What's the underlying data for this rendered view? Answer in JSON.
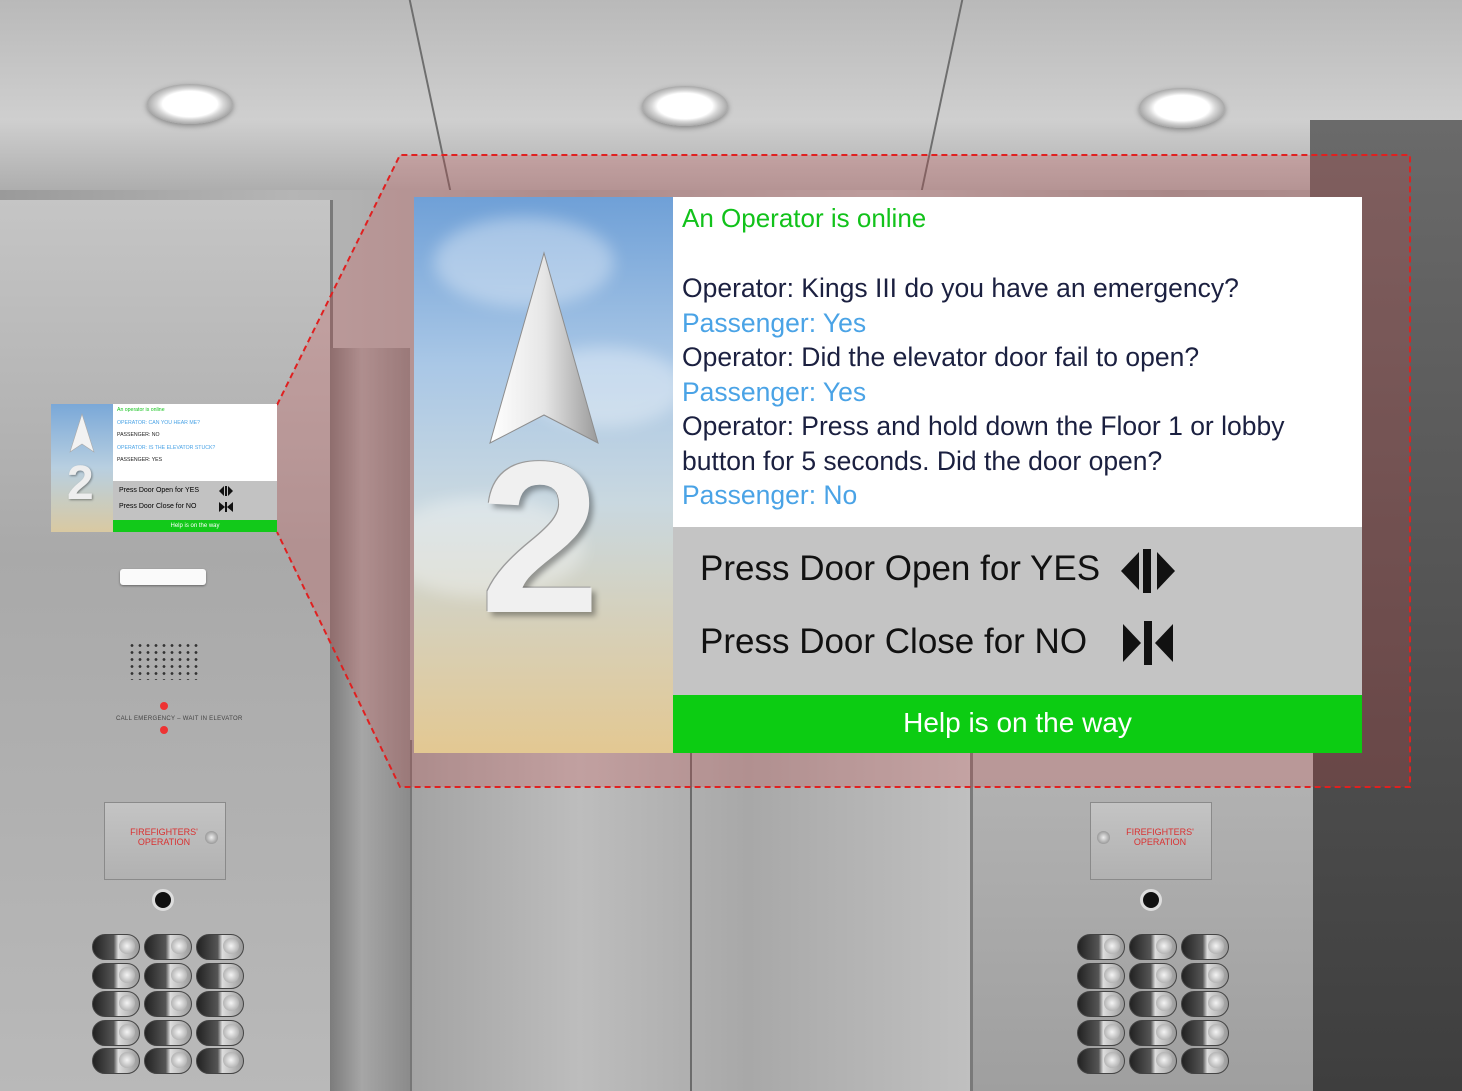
{
  "screen": {
    "floor_number": "2",
    "status": "An Operator is online",
    "conversation": [
      {
        "speaker": "operator",
        "text": "Operator: Kings III do you have an emergency?"
      },
      {
        "speaker": "passenger",
        "text": "Passenger: Yes"
      },
      {
        "speaker": "operator",
        "text": "Operator: Did the elevator door fail to open?"
      },
      {
        "speaker": "passenger",
        "text": "Passenger: Yes"
      },
      {
        "speaker": "operator",
        "text": "Operator: Press and hold down the Floor 1 or lobby button for 5 seconds. Did the door open?"
      },
      {
        "speaker": "passenger",
        "text": "Passenger: No"
      }
    ],
    "prompt_yes": "Press Door Open for YES",
    "prompt_no": "Press Door Close for NO",
    "yes_icon": "door-open-icon",
    "no_icon": "door-close-icon",
    "help_text": "Help is on the way"
  },
  "mini_display": {
    "status": "An operator is online",
    "lines": [
      {
        "speaker": "operator",
        "text": "OPERATOR: CAN YOU HEAR ME?"
      },
      {
        "speaker": "passenger",
        "text": "PASSENGER: NO"
      },
      {
        "speaker": "operator",
        "text": "OPERATOR: IS THE ELEVATOR STUCK?"
      },
      {
        "speaker": "passenger",
        "text": "PASSENGER: YES"
      }
    ],
    "prompt_yes": "Press Door Open for YES",
    "prompt_no": "Press Door Close for NO",
    "help_text": "Help is on the way",
    "floor_number": "2"
  },
  "panel": {
    "call_label": "CALL EMERGENCY – WAIT IN ELEVATOR",
    "firefighters_left": "FIREFIGHTERS' OPERATION",
    "firefighters_right": "FIREFIGHTERS' OPERATION"
  },
  "colors": {
    "status_green": "#12c21b",
    "operator_text": "#1b2040",
    "passenger_text": "#4aa3e6",
    "help_bar": "#0ccc12",
    "prompt_bg": "#c4c4c4",
    "callout_red": "#e02020"
  }
}
